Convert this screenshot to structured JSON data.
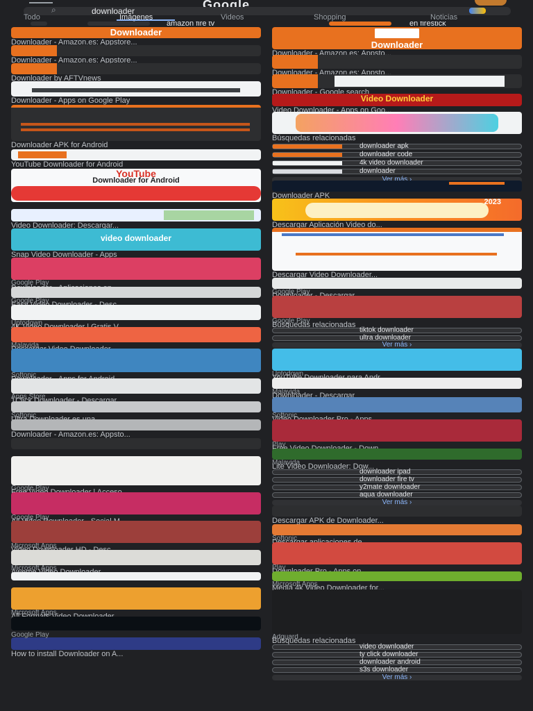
{
  "header": {
    "brand": "Google",
    "search_value": "downloader",
    "search_icon": "search-icon",
    "lens_icon": "google-lens-icon"
  },
  "tabs": [
    {
      "label": "Todo"
    },
    {
      "label": "Imágenes"
    },
    {
      "label": "Videos"
    },
    {
      "label": "Shopping"
    },
    {
      "label": "Noticias"
    }
  ],
  "chips": [
    {
      "label": "amazon fire tv"
    },
    {
      "label": "en firestick"
    }
  ],
  "left": {
    "card1": {
      "title": "Downloader",
      "caption": "Downloader - Amazon.es: Appstore..."
    },
    "card2": {
      "caption": "Downloader - Amazon.es: Appstore..."
    },
    "card3": {
      "caption": "Downloader by AFTVnews"
    },
    "card4": {
      "caption": "Downloader - Apps on Google Play"
    },
    "card5": {
      "caption": "Downloader APK for Android"
    },
    "card6": {
      "title": "YouTube",
      "subtitle": "Downloader for Android",
      "caption": "YouTube Downloader for Android"
    },
    "card7": {
      "caption": "Video Downloader: Descargar..."
    },
    "card8": {
      "title": "video downloader",
      "caption": "Snap Video Downloader - Apps"
    },
    "card9": {
      "source": "Google Play",
      "caption": "Downloader - Aplicaciones en..."
    },
    "card10": {
      "source": "Google Play",
      "caption": "Easy Video Downloader - Desc..."
    },
    "card11": {
      "source": "Uptodown",
      "caption": "4K Video Downloader | Gratis V..."
    },
    "card12": {
      "source": "Malavida",
      "caption": "Descargar Video Downloader"
    },
    "card13": {
      "source": "Softonic",
      "caption": "Downloader - Apps for Android"
    },
    "card14": {
      "source": "Apps Store",
      "caption": "1Click Downloader - Descargar"
    },
    "card15": {
      "source": "Softonic",
      "caption": "Ultra Downloader es una..."
    },
    "card16": {
      "caption": "Downloader - Amazon.es: Appsto..."
    },
    "card17": {
      "source": "Google Play",
      "caption": "Free Video Downloader | Acceso..."
    },
    "card18": {
      "source": "Google Play",
      "caption": "All Video Downloader - Social M..."
    },
    "card19": {
      "source": "Microsoft Apps",
      "caption": "Video Downloader HD - Desc..."
    },
    "card20": {
      "source": "Microsoft Apps",
      "caption": "Aweme Video Downloader"
    },
    "card21": {
      "source": "Microsoft Apps",
      "caption": "All Formats Video Downloader"
    },
    "card22": {
      "source": "Google Play",
      "caption": "How to install Downloader on A..."
    }
  },
  "right": {
    "card1": {
      "title": "Downloader",
      "caption": "Downloader - Amazon.es: Appsto..."
    },
    "card2": {
      "caption": "Downloader - Amazon.es: Appsto..."
    },
    "card3": {
      "caption": "Downloader - Google search"
    },
    "card4": {
      "title": "Video Downloader",
      "caption": "Video Downloader - Apps on Goo..."
    },
    "card5": {
      "caption": "Búsquedas relacionadas"
    },
    "related1": [
      {
        "label": "downloader apk"
      },
      {
        "label": "downloader code"
      },
      {
        "label": "4k video downloader"
      },
      {
        "label": "downloader"
      }
    ],
    "ver_mas_1": "Ver más ›",
    "card6": {
      "caption": "Downloader APK"
    },
    "card7": {
      "title": "2023",
      "caption": "Descargar Aplicación Video do..."
    },
    "card8": {
      "caption": "Descargar Video Downloader..."
    },
    "card9": {
      "source": "Google Play",
      "caption": "Downloader - Descargar..."
    },
    "card10": {
      "source": "Google Play",
      "caption": "Búsquedas relacionadas"
    },
    "related2": [
      {
        "label": "tiktok downloader"
      },
      {
        "label": "ultra downloader"
      }
    ],
    "ver_mas_2": "Ver más ›",
    "card11": {
      "source": "Uptodown",
      "caption": "YouTube Downloader para Andr..."
    },
    "card12": {
      "source": "Malavida",
      "caption": "Downloader - Descargar"
    },
    "card13": {
      "source": "Softonic",
      "caption": "Video Downloader Pro - Apps"
    },
    "card14": {
      "source": "Play",
      "caption": "Free Video Downloader - Down..."
    },
    "card15": {
      "source": "Malavida",
      "caption": "Lite Video Downloader: Dow..."
    },
    "related3": [
      {
        "label": "downloader ipad"
      },
      {
        "label": "downloader fire tv"
      },
      {
        "label": "y2mate downloader"
      },
      {
        "label": "aqua downloader"
      }
    ],
    "ver_mas_3": "Ver más ›",
    "card16": {
      "caption": "Descargar APK de Downloader..."
    },
    "card17": {
      "source": "Softonic",
      "caption": "Descargar aplicaciones de..."
    },
    "card18": {
      "source": "Play",
      "caption": "Downloader Pro - Apps on..."
    },
    "card19": {
      "source": "Microsoft Apps",
      "caption": "Media 4k Video Downloader for..."
    },
    "card20": {
      "source": "Adguard",
      "caption": "Búsquedas relacionadas"
    },
    "related4": [
      {
        "label": "video downloader"
      },
      {
        "label": "ty click downloader"
      },
      {
        "label": "downloader android"
      },
      {
        "label": "s3s downloader"
      }
    ],
    "ver_mas_4": "Ver más ›"
  }
}
